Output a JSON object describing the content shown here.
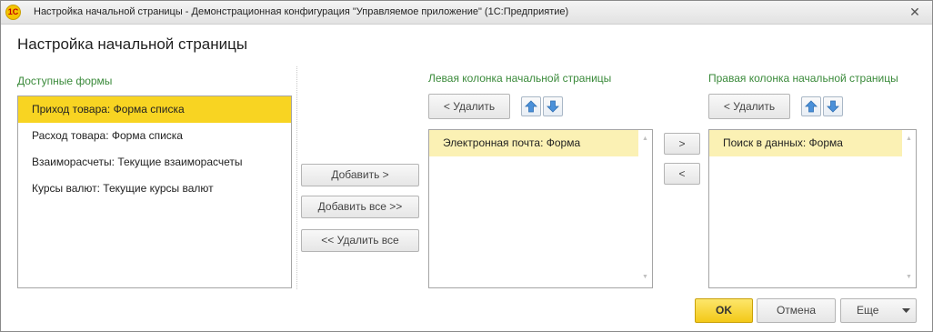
{
  "window": {
    "app_icon_label": "1С",
    "title": "Настройка начальной страницы - Демонстрационная конфигурация \"Управляемое приложение\"  (1С:Предприятие)",
    "close_symbol": "✕"
  },
  "page_title": "Настройка начальной страницы",
  "available": {
    "label": "Доступные формы",
    "items": [
      "Приход товара: Форма списка",
      "Расход товара: Форма списка",
      "Взаиморасчеты: Текущие взаиморасчеты",
      "Курсы валют: Текущие курсы валют"
    ],
    "selected_index": 0
  },
  "middle_buttons": {
    "add": "Добавить >",
    "add_all": "Добавить все >>",
    "remove_all": "<< Удалить все"
  },
  "left_column": {
    "label": "Левая колонка начальной страницы",
    "remove": "< Удалить",
    "items": [
      "Электронная почта: Форма"
    ]
  },
  "move_buttons": {
    "right": ">",
    "left": "<"
  },
  "right_column": {
    "label": "Правая колонка начальной страницы",
    "remove": "< Удалить",
    "items": [
      "Поиск в данных: Форма"
    ]
  },
  "footer": {
    "ok": "OK",
    "cancel": "Отмена",
    "more": "Еще"
  },
  "colors": {
    "selected": "#f8d422",
    "highlight": "#fbf1b4",
    "group_label": "#3a8a3a",
    "ok_button": "#f3c918"
  },
  "icons": [
    "app-logo-icon",
    "close-icon",
    "arrow-up-icon",
    "arrow-down-icon",
    "dropdown-arrow-icon"
  ]
}
